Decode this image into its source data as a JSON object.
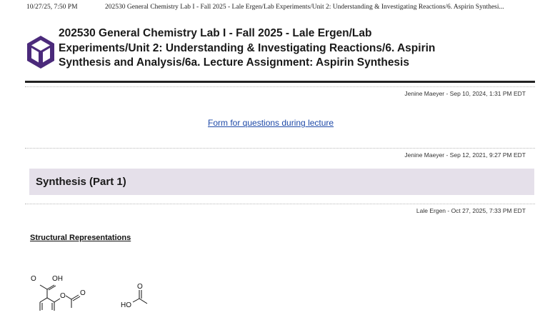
{
  "print_header": {
    "date": "10/27/25, 7:50 PM",
    "title": "202530 General Chemistry Lab I - Fall 2025 - Lale Ergen/Lab Experiments/Unit 2: Understanding & Investigating Reactions/6. Aspirin Synthesi..."
  },
  "page": {
    "title": "202530 General Chemistry Lab I - Fall 2025 - Lale Ergen/Lab Experiments/Unit 2: Understanding & Investigating Reactions/6. Aspirin Synthesis and Analysis/6a. Lecture Assignment: Aspirin Synthesis",
    "logo_icon": "cube-logo-icon",
    "accent_color": "#4b2a7b"
  },
  "entries": [
    {
      "meta": "Jenine Maeyer - Sep 10, 2024, 1:31 PM EDT",
      "link_text": "Form for questions during lecture"
    },
    {
      "meta": "Jenine Maeyer - Sep 12, 2021, 9:27 PM EDT",
      "section_title": "Synthesis (Part 1)",
      "section_bg": "#e5e0ea"
    },
    {
      "meta": "Lale Ergen - Oct 27, 2025, 7:33 PM EDT",
      "subheading": "Structural Representations"
    }
  ],
  "molecules": {
    "aspirin_labels": [
      "O",
      "OH",
      "O",
      "O"
    ],
    "acetic_acid_labels": [
      "O",
      "HO"
    ]
  }
}
